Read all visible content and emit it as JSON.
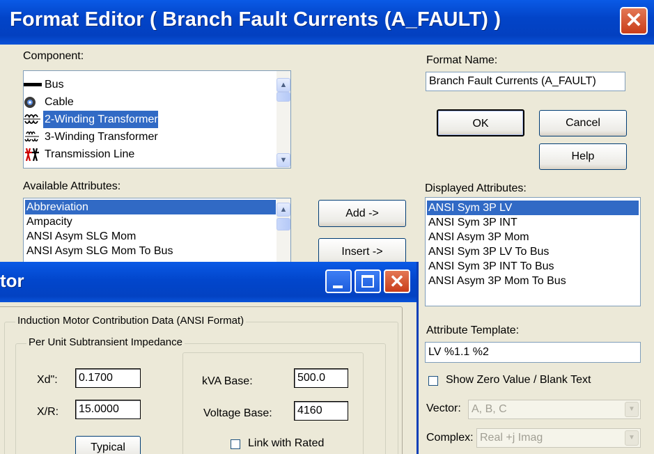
{
  "main_dialog": {
    "title": "Format Editor ( Branch Fault Currents (A_FAULT) )",
    "close_glyph": "✕",
    "component_label": "Component:",
    "components": [
      {
        "label": "Bus",
        "icon": "bus-icon",
        "selected": false
      },
      {
        "label": "Cable",
        "icon": "cable-icon",
        "selected": false
      },
      {
        "label": "2-Winding Transformer",
        "icon": "2-winding-transformer-icon",
        "selected": true
      },
      {
        "label": "3-Winding Transformer",
        "icon": "3-winding-transformer-icon",
        "selected": false
      },
      {
        "label": "Transmission Line",
        "icon": "transmission-line-icon",
        "selected": false
      }
    ],
    "format_name_label": "Format Name:",
    "format_name_value": "Branch Fault Currents (A_FAULT)",
    "ok_label": "OK",
    "cancel_label": "Cancel",
    "help_label": "Help",
    "available_attributes_label": "Available Attributes:",
    "available_attributes": [
      {
        "label": "Abbreviation",
        "selected": true
      },
      {
        "label": "Ampacity",
        "selected": false
      },
      {
        "label": "ANSI Asym SLG Mom",
        "selected": false
      },
      {
        "label": "ANSI Asym SLG Mom To Bus",
        "selected": false
      }
    ],
    "add_label": "Add ->",
    "insert_label": "Insert ->",
    "displayed_attributes_label": "Displayed Attributes:",
    "displayed_attributes": [
      {
        "label": "ANSI Sym 3P LV",
        "selected": true
      },
      {
        "label": "ANSI Sym 3P INT",
        "selected": false
      },
      {
        "label": "ANSI Asym 3P Mom",
        "selected": false
      },
      {
        "label": "ANSI Sym 3P LV To Bus",
        "selected": false
      },
      {
        "label": "ANSI Sym 3P INT To Bus",
        "selected": false
      },
      {
        "label": "ANSI Asym 3P Mom To Bus",
        "selected": false
      }
    ],
    "attribute_template_label": "Attribute Template:",
    "attribute_template_value": "LV %1.1 %2",
    "show_zero_label": "Show Zero Value / Blank Text",
    "show_zero_checked": false,
    "vector_label": "Vector:",
    "vector_value": "A, B, C",
    "complex_label": "Complex:",
    "complex_value": "Real +j Imag"
  },
  "editor_window": {
    "title_fragment": "tor",
    "group_title": "Induction Motor Contribution Data (ANSI Format)",
    "subgroup_title": "Per Unit Subtransient Impedance",
    "xd_label": "Xd\":",
    "xd_value": "0.1700",
    "xr_label": "X/R:",
    "xr_value": "15.0000",
    "typical_label": "Typical",
    "kva_base_label": "kVA Base:",
    "kva_base_value": "500.0",
    "voltage_base_label": "Voltage Base:",
    "voltage_base_value": "4160",
    "link_rated_label": "Link with Rated",
    "link_rated_checked": false
  },
  "colors": {
    "title_blue": "#0246cc",
    "selection_blue": "#316ac5",
    "dialog_face": "#ece9d8",
    "close_red": "#d9542e"
  }
}
